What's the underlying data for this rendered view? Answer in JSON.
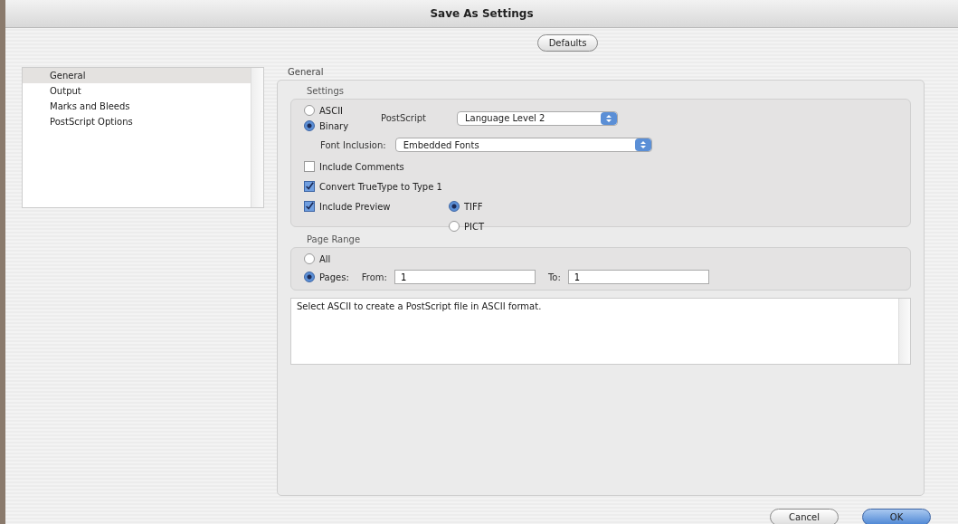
{
  "window": {
    "title": "Save As Settings"
  },
  "defaults_button": {
    "label": "Defaults"
  },
  "sidebar": {
    "items": [
      {
        "label": "General",
        "selected": true
      },
      {
        "label": "Output",
        "selected": false
      },
      {
        "label": "Marks and Bleeds",
        "selected": false
      },
      {
        "label": "PostScript Options",
        "selected": false
      }
    ]
  },
  "panel": {
    "title": "General"
  },
  "settings": {
    "title": "Settings",
    "format_options": [
      {
        "label": "ASCII",
        "selected": false
      },
      {
        "label": "Binary",
        "selected": true
      }
    ],
    "postscript": {
      "label": "PostScript",
      "value": "Language Level 2"
    },
    "font_inclusion": {
      "label": "Font Inclusion:",
      "value": "Embedded Fonts"
    },
    "checkboxes": [
      {
        "label": "Include Comments",
        "checked": false
      },
      {
        "label": "Convert TrueType to Type 1",
        "checked": true
      },
      {
        "label": "Include Preview",
        "checked": true
      }
    ],
    "preview_formats": [
      {
        "label": "TIFF",
        "selected": true
      },
      {
        "label": "PICT",
        "selected": false
      }
    ]
  },
  "page_range": {
    "title": "Page Range",
    "options": [
      {
        "label": "All",
        "selected": false
      },
      {
        "label": "Pages:",
        "selected": true
      }
    ],
    "from": {
      "label": "From:",
      "value": "1"
    },
    "to": {
      "label": "To:",
      "value": "1"
    }
  },
  "description": "Select ASCII to create a PostScript file in ASCII format.",
  "buttons": [
    {
      "label": "Cancel",
      "kind": "secondary"
    },
    {
      "label": "OK",
      "kind": "default"
    }
  ]
}
